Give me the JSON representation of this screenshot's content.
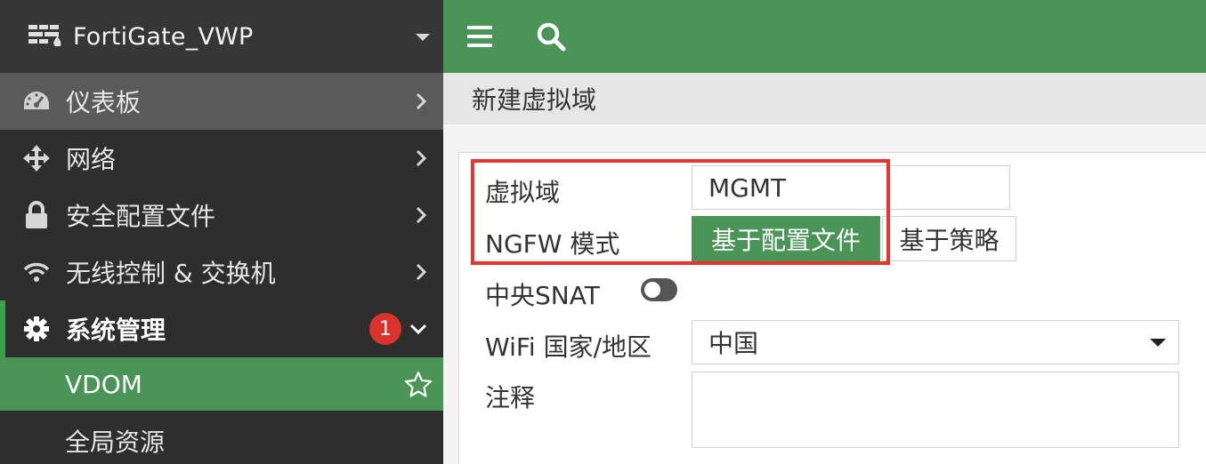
{
  "sidebar": {
    "device_name": "FortiGate_VWP",
    "items": [
      {
        "label": "仪表板",
        "icon": "dashboard-gauge-icon"
      },
      {
        "label": "网络",
        "icon": "network-arrows-icon"
      },
      {
        "label": "安全配置文件",
        "icon": "lock-icon"
      },
      {
        "label": "无线控制 & 交换机",
        "icon": "wifi-icon"
      },
      {
        "label": "系统管理",
        "icon": "gear-icon",
        "badge": "1"
      }
    ],
    "sub_items": [
      {
        "label": "VDOM"
      },
      {
        "label": "全局资源"
      }
    ]
  },
  "topbar": {
    "menu_icon": "hamburger-menu-icon",
    "search_icon": "search-icon"
  },
  "breadcrumb": "新建虚拟域",
  "form": {
    "vdom_label": "虚拟域",
    "vdom_value": "MGMT",
    "ngfw_label": "NGFW 模式",
    "ngfw_options": [
      "基于配置文件",
      "基于策略"
    ],
    "ngfw_selected": "基于配置文件",
    "snat_label": "中央SNAT",
    "snat_enabled": false,
    "wifi_label": "WiFi 国家/地区",
    "wifi_value": "中国",
    "comment_label": "注释",
    "comment_value": ""
  },
  "colors": {
    "brand_green": "#4a9458",
    "sidebar_bg": "#2e2e2e",
    "highlight_red": "#e8332f",
    "badge_red": "#d9332b"
  }
}
